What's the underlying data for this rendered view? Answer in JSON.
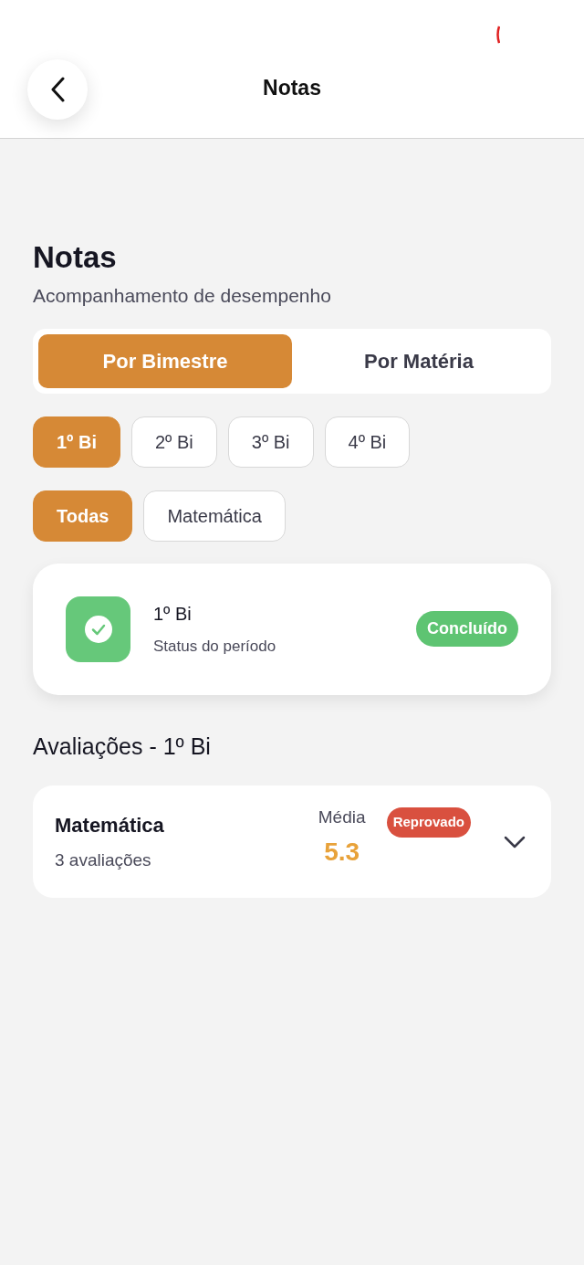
{
  "header": {
    "title": "Notas"
  },
  "page": {
    "title": "Notas",
    "subtitle": "Acompanhamento de desempenho"
  },
  "view_tabs": [
    {
      "label": "Por Bimestre",
      "selected": true
    },
    {
      "label": "Por Matéria",
      "selected": false
    }
  ],
  "period_chips": [
    {
      "label": "1º Bi",
      "selected": true
    },
    {
      "label": "2º Bi",
      "selected": false
    },
    {
      "label": "3º Bi",
      "selected": false
    },
    {
      "label": "4º Bi",
      "selected": false
    }
  ],
  "subject_chips": [
    {
      "label": "Todas",
      "selected": true
    },
    {
      "label": "Matemática",
      "selected": false
    }
  ],
  "status_card": {
    "title": "1º Bi",
    "subtitle": "Status do período",
    "badge": "Concluído",
    "done": true
  },
  "section_title": "Avaliações - 1º Bi",
  "subjects": [
    {
      "name": "Matemática",
      "count": "3 avaliações",
      "average_label": "Média",
      "average": "5.3",
      "badge": "Reprovado",
      "passed": false,
      "expanded": false
    }
  ]
}
